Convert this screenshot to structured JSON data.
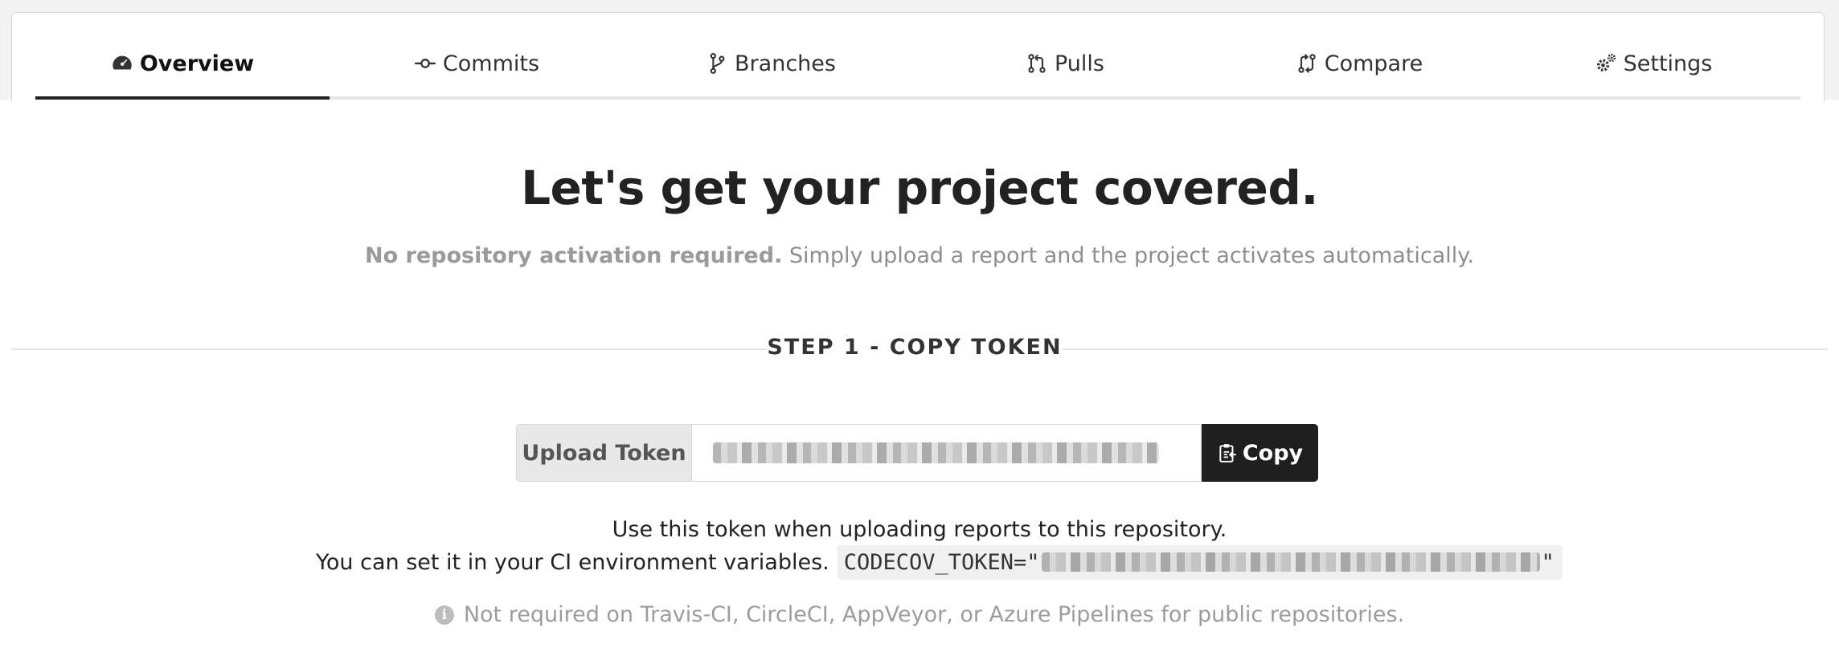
{
  "tabs": [
    {
      "label": "Overview",
      "icon": "dashboard-icon",
      "active": true
    },
    {
      "label": "Commits",
      "icon": "commit-icon",
      "active": false
    },
    {
      "label": "Branches",
      "icon": "branch-icon",
      "active": false
    },
    {
      "label": "Pulls",
      "icon": "pull-request-icon",
      "active": false
    },
    {
      "label": "Compare",
      "icon": "compare-icon",
      "active": false
    },
    {
      "label": "Settings",
      "icon": "gear-icon",
      "active": false
    }
  ],
  "hero": {
    "title": "Let's get your project covered.",
    "subtitle_bold": "No repository activation required.",
    "subtitle_rest": " Simply upload a report and the project activates automatically."
  },
  "step1": {
    "title": "STEP 1 - COPY TOKEN",
    "token_label": "Upload Token",
    "copy_label": "Copy",
    "help_line1": "Use this token when uploading reports to this repository.",
    "help_line2": "You can set it in your CI environment variables.",
    "env_prefix": "CODECOV_TOKEN=\"",
    "env_suffix": "\"",
    "note": "Not required on Travis-CI, CircleCI, AppVeyor, or Azure Pipelines for public repositories."
  },
  "colors": {
    "active_tab_underline": "#222222",
    "copy_button": "#1f1f1f"
  }
}
